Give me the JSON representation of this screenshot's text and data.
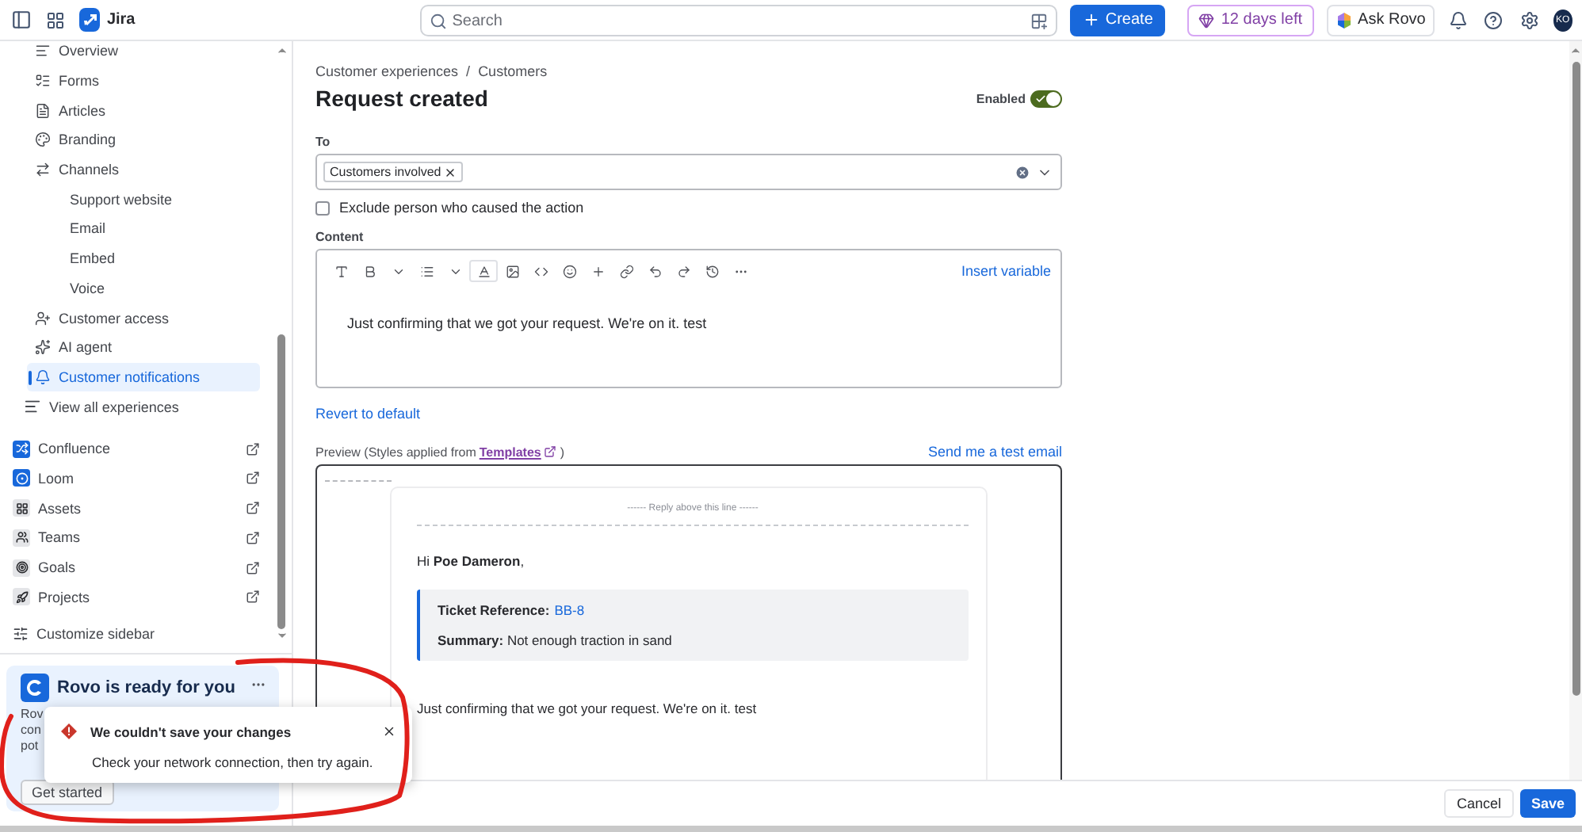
{
  "topbar": {
    "product": "Jira",
    "search": {
      "placeholder": "Search"
    },
    "create": "Create",
    "trial": "12 days left",
    "ask": "Ask Rovo",
    "avatar": "KO"
  },
  "sidebar": {
    "items": [
      {
        "label": "Overview",
        "selected": false
      },
      {
        "label": "Forms",
        "selected": false
      },
      {
        "label": "Articles",
        "selected": false
      },
      {
        "label": "Branding",
        "selected": false
      },
      {
        "label": "Channels",
        "selected": false,
        "children": [
          {
            "label": "Support website",
            "selected": false
          },
          {
            "label": "Email",
            "selected": false
          },
          {
            "label": "Embed",
            "selected": false
          },
          {
            "label": "Voice",
            "selected": false
          }
        ]
      },
      {
        "label": "Customer access",
        "selected": false
      },
      {
        "label": "AI agent",
        "selected": false
      },
      {
        "label": "Customer notifications",
        "selected": true
      }
    ],
    "view_all": "View all experiences",
    "apps": [
      "Confluence",
      "Loom",
      "Assets",
      "Teams",
      "Goals",
      "Projects"
    ],
    "customize": "Customize sidebar",
    "rovo_card": {
      "title": "Rovo is ready for you",
      "lines": [
        "Rov",
        "con",
        "pot"
      ],
      "button": "Get started"
    }
  },
  "breadcrumbs": [
    "Customer experiences",
    "Customers"
  ],
  "breadcrumb_separator": "/",
  "title": "Request created",
  "enabled": {
    "label": "Enabled",
    "on": true
  },
  "to": {
    "label": "To",
    "tags": [
      "Customers involved"
    ]
  },
  "exclude": {
    "label": "Exclude person who caused the action",
    "checked": false
  },
  "content": {
    "label": "Content",
    "insert": "Insert variable",
    "body": "Just confirming that we got your request. We're on it. test"
  },
  "revert": "Revert to default",
  "preview": {
    "label": "Preview (Styles applied from",
    "link": "Templates",
    "label_end": ")",
    "send": "Send me a test email",
    "email": {
      "divider": "------ Reply above this line ------",
      "greeting": "Hi **Poe Dameron**,",
      "reference": "**Ticket Reference:**",
      "ref_link": "BB-8",
      "summary": "**Summary:** Not enough traction in sand",
      "body": "Just confirming that we got your request. We're on it. test"
    }
  },
  "footer": {
    "cancel": "Cancel",
    "save": "Save"
  },
  "toast": {
    "title": "We couldn't save your changes",
    "message": "Check your network connection, then try again."
  }
}
